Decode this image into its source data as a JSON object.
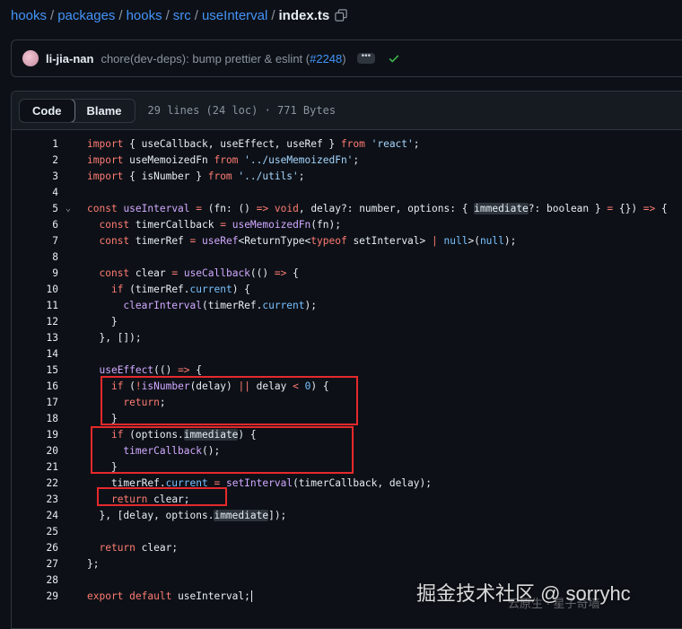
{
  "breadcrumb": {
    "segments": [
      "hooks",
      "packages",
      "hooks",
      "src",
      "useInterval"
    ],
    "file": "index.ts"
  },
  "commit": {
    "author": "li-jia-nan",
    "message": "chore(dev-deps): bump prettier & eslint (",
    "pr": "#2248",
    "message_end": ")",
    "dots": "•••"
  },
  "toolbar": {
    "code_label": "Code",
    "blame_label": "Blame",
    "file_info": "29 lines (24 loc) · 771 Bytes"
  },
  "watermark": {
    "text": "掘金技术社区 @ sorryhc",
    "sub": "云原生 · 星子奇墙"
  },
  "colors": {
    "background": "#0d1117",
    "link": "#4493f8",
    "keyword": "#ff7b72",
    "function": "#d2a8ff",
    "string": "#a5d6ff",
    "annotation_box": "#e5292b"
  }
}
